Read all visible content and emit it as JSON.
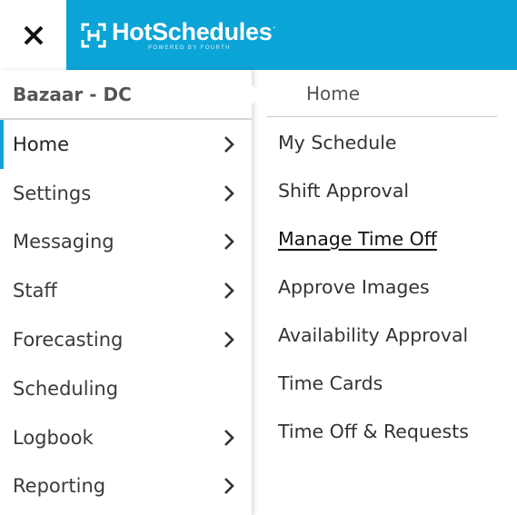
{
  "brand": {
    "name": "HotSchedules",
    "trademark": ".",
    "tagline": "POWERED BY FOURTH",
    "bar_color": "#0ba4d6"
  },
  "close_button": {
    "icon": "close-icon"
  },
  "location": {
    "name": "Bazaar - DC"
  },
  "nav": {
    "items": [
      {
        "label": "Home",
        "has_submenu": true,
        "active": true
      },
      {
        "label": "Settings",
        "has_submenu": true,
        "active": false
      },
      {
        "label": "Messaging",
        "has_submenu": true,
        "active": false
      },
      {
        "label": "Staff",
        "has_submenu": true,
        "active": false
      },
      {
        "label": "Forecasting",
        "has_submenu": true,
        "active": false
      },
      {
        "label": "Scheduling",
        "has_submenu": false,
        "active": false
      },
      {
        "label": "Logbook",
        "has_submenu": true,
        "active": false
      },
      {
        "label": "Reporting",
        "has_submenu": true,
        "active": false
      }
    ]
  },
  "submenu": {
    "heading": "Home",
    "items": [
      {
        "label": "My Schedule",
        "current": false
      },
      {
        "label": "Shift Approval",
        "current": false
      },
      {
        "label": "Manage Time Off",
        "current": true
      },
      {
        "label": "Approve Images",
        "current": false
      },
      {
        "label": "Availability Approval",
        "current": false
      },
      {
        "label": "Time Cards",
        "current": false
      },
      {
        "label": "Time Off & Requests",
        "current": false
      }
    ]
  }
}
